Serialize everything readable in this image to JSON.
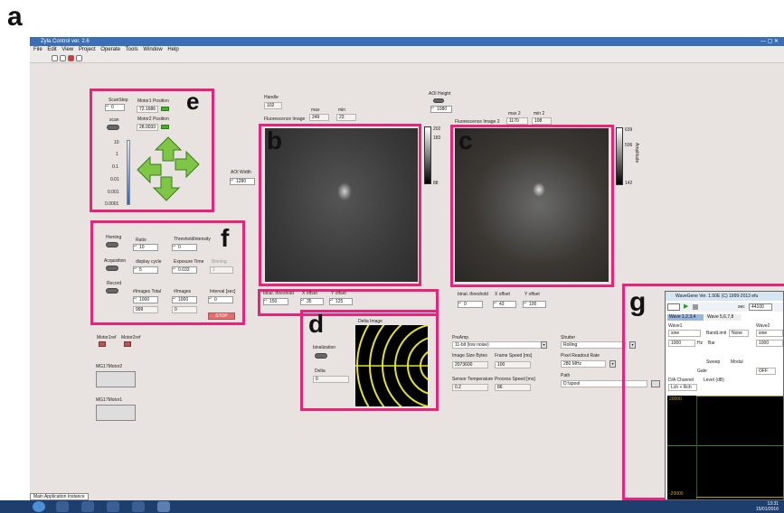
{
  "figure_letter": "a",
  "window": {
    "title": "Zyla Control ver. 2.6"
  },
  "menu": [
    "File",
    "Edit",
    "View",
    "Project",
    "Operate",
    "Tools",
    "Window",
    "Help"
  ],
  "panels": {
    "e": "e",
    "f": "f",
    "b": "b",
    "c": "c",
    "d": "d",
    "g": "g"
  },
  "scan": {
    "scanstep_label": "ScanStep",
    "scanstep_value": "0",
    "motor1_label": "Motor1 Position",
    "motor1_value": "72.1686",
    "motor2_label": "Motor2 Position",
    "motor2_value": "28.0033",
    "scan_label": "scan",
    "slider_ticks": [
      "10",
      "1",
      "0.1",
      "0.01",
      "0.001",
      "0.0001"
    ],
    "aoi_width_label": "AOI Width",
    "aoi_width_value": "1280"
  },
  "image1": {
    "handle_label": "Handle",
    "handle_value": "102",
    "max_label": "max",
    "max_value": "249",
    "min_label": "min",
    "min_value": "23",
    "title": "Fluorescence Image",
    "cbar_ticks": [
      "202",
      "183",
      "88"
    ],
    "binal_label": "binal. threshold",
    "binal_value": "150",
    "xoff_label": "X offset",
    "xoff_value": "35",
    "yoff_label": "Y offset",
    "yoff_value": "125"
  },
  "image2": {
    "aoi_height_label": "AOI Height",
    "aoi_height_value": "1080",
    "max2_label": "max 2",
    "max2_value": "1170",
    "min2_label": "min 2",
    "min2_value": "108",
    "title": "Fluorescence Image 2",
    "cbar_ticks": [
      "639",
      "506",
      "142"
    ],
    "cbar_axis": "Amplitude",
    "binal_label": "binal. threshold",
    "binal_value": "0",
    "xoff_label": "X offset",
    "xoff_value": "43",
    "yoff_label": "Y offset",
    "yoff_value": "100"
  },
  "control": {
    "homing_label": "Homing",
    "ratio_label": "Ratio",
    "ratio_value": "10",
    "threshold_label": "ThresholdIntensity",
    "threshold_value": "0",
    "acq_label": "Acquisition",
    "display_label": "display cycle",
    "display_value": "5",
    "exposure_label": "Exposure Time",
    "exposure_value": "0.033",
    "binning_label": "Binning",
    "binning_value": "1",
    "record_label": "Record",
    "images_total_label": "#Images Total",
    "images_total_value": "1000",
    "images_total_sub": "999",
    "images_label": "#Images",
    "images_value": "1000",
    "images_sub": "0",
    "interval_label": "Interval [sec]",
    "interval_value": "0",
    "stop_label": "STOP"
  },
  "motors": {
    "motor1ref": "Motor1ref",
    "motor2ref": "Motor2ref",
    "mg17_2": "MG17Motor2",
    "mg17_1": "MG17Motor1"
  },
  "delta": {
    "binalization_label": "binalization",
    "delta_label": "Delta",
    "delta_value": "0",
    "delta_image_label": "Delta Image"
  },
  "camera": {
    "preamp_label": "PreAmp",
    "preamp_value": "11-bit (low noise)",
    "shutter_label": "Shutter",
    "shutter_value": "Rolling",
    "img_size_label": "Image Size Bytes",
    "img_size_value": "2073600",
    "frame_speed_label": "Frame Speed [ms]",
    "frame_speed_value": "100",
    "pixel_rate_label": "Pixel Readout Rate",
    "pixel_rate_value": "280 MHz",
    "sensor_temp_label": "Sensor Temperature",
    "sensor_temp_value": "0.2",
    "proc_speed_label": "Process Speed [ms]",
    "proc_speed_value": "86",
    "path_label": "Path",
    "path_value": "D:\\spool"
  },
  "wavegene": {
    "title": "WaveGene Ver. 1.50E (C) 1999-2013 efu",
    "tab1": "Wave 1,2,3,4",
    "tab2": "Wave 5,6,7,8",
    "wave1_label": "Wave1",
    "wave2_label": "Wave2",
    "sine": "sine",
    "freq": "1000",
    "freq_unit": "Hz",
    "bar_label": "Bar",
    "bandlimit_label": "BandLimit",
    "bandlimit_value": "None",
    "sweep_label": "Sweep",
    "modul_label": "Modul",
    "off_label": "OFF",
    "gate_label": "Gate",
    "level_label": "Level (dB)",
    "chan_label": "D/A Channel",
    "lch_rch": "Lch + Rch",
    "sec_value": "44100",
    "rate_label": "sec",
    "scope_top": "20000",
    "scope_bottom": "-20000"
  },
  "taskbar": {
    "tab_label": "Main Application Instance",
    "clock_time": "13:31",
    "clock_date": "15/01/2016"
  }
}
